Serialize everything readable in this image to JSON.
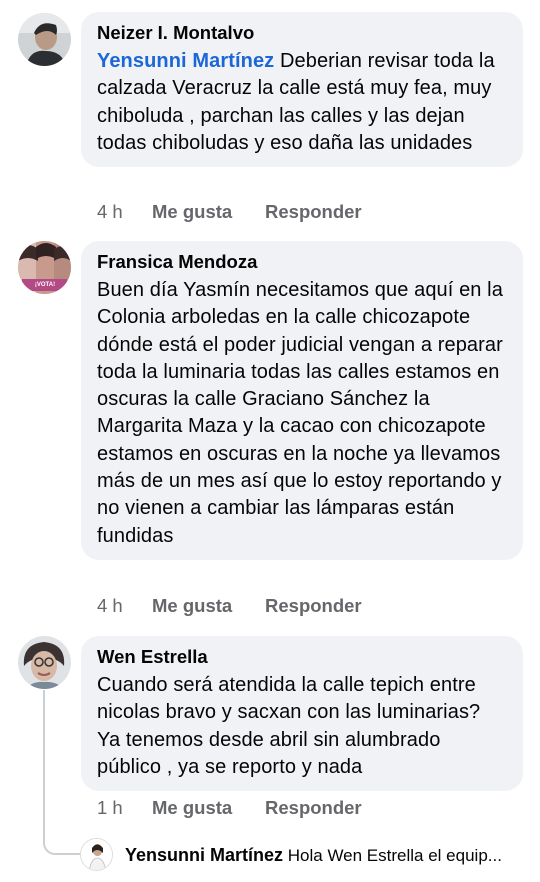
{
  "comments": [
    {
      "author": "Neizer I. Montalvo",
      "mention": "Yensunni Martínez",
      "text": " Deberian revisar toda la calzada Veracruz la calle está muy fea, muy chiboluda , parchan las calles y las dejan todas chiboludas y eso daña las unidades",
      "time": "4 h",
      "like": "Me gusta",
      "reply": "Responder"
    },
    {
      "author": "Fransica Mendoza",
      "text": "Buen día Yasmín necesitamos que aquí en la Colonia arboledas en la calle chicozapote dónde está el poder judicial vengan a reparar toda la luminaria todas las calles estamos en oscuras la calle Graciano Sánchez la Margarita Maza y la cacao con chicozapote estamos en oscuras en la noche ya llevamos más de un mes así que lo estoy reportando y no vienen a cambiar las lámparas están fundidas",
      "badge": "¡VOTA!",
      "time": "4 h",
      "like": "Me gusta",
      "reply": "Responder"
    },
    {
      "author": "Wen Estrella",
      "text": "Cuando será atendida la calle tepich entre nicolas bravo y sacxan con las luminarias? Ya tenemos desde abril sin alumbrado público , ya se reporto y nada",
      "time": "1 h",
      "like": "Me gusta",
      "reply": "Responder"
    }
  ],
  "reply_preview": {
    "author": "Yensunni Martínez",
    "text": " Hola Wen Estrella el equip..."
  },
  "colors": {
    "bubble": "#f0f2f5",
    "mention": "#1b67d8",
    "meta": "#65676b"
  }
}
